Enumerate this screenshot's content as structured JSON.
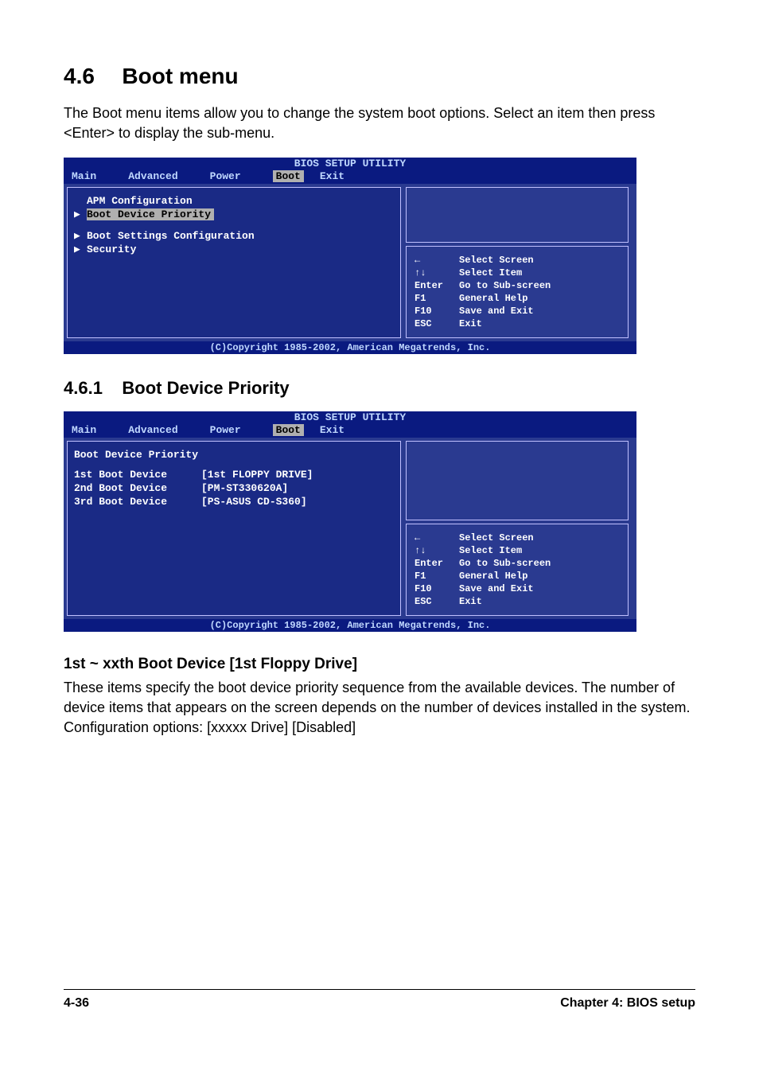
{
  "section": {
    "number": "4.6",
    "title": "Boot menu"
  },
  "intro": "The Boot menu items allow you to change the system boot options. Select an item then press <Enter> to display the sub-menu.",
  "bios_title": "BIOS SETUP UTILITY",
  "tabs": {
    "main": "Main",
    "advanced": "Advanced",
    "power": "Power",
    "boot": "Boot",
    "exit": "Exit"
  },
  "bios1": {
    "items": {
      "apm": "APM Configuration",
      "priority": "Boot Device Priority",
      "settings": "Boot Settings Configuration",
      "security": "Security"
    }
  },
  "help_keys": {
    "arrow_lr": "←",
    "arrow_ud": "↑↓",
    "enter": "Enter",
    "f1": "F1",
    "f10": "F10",
    "esc": "ESC"
  },
  "help_labels": {
    "select_screen": "Select Screen",
    "select_item": "Select Item",
    "sub": "Go to Sub-screen",
    "general": "General Help",
    "save": "Save and Exit",
    "exit": "Exit"
  },
  "copyright": "(C)Copyright 1985-2002, American Megatrends, Inc.",
  "subsection": {
    "number": "4.6.1",
    "title": "Boot Device Priority"
  },
  "bios2": {
    "header": "Boot Device Priority",
    "devices": [
      {
        "label": "1st Boot Device",
        "value": "[1st FLOPPY DRIVE]"
      },
      {
        "label": "2nd Boot Device",
        "value": "[PM-ST330620A]"
      },
      {
        "label": "3rd Boot Device",
        "value": "[PS-ASUS CD-S360]"
      }
    ]
  },
  "sub3": {
    "title": "1st ~ xxth Boot Device [1st Floppy Drive]",
    "body1": "These items specify the boot device priority sequence from the available devices. The number of device items that appears on the screen depends on the number of devices installed in the system.",
    "body2": "Configuration options: [xxxxx Drive] [Disabled]"
  },
  "footer": {
    "page": "4-36",
    "chapter": "Chapter 4: BIOS setup"
  }
}
